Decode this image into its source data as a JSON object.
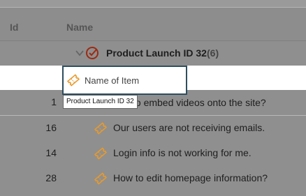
{
  "header": {
    "id_label": "Id",
    "name_label": "Name"
  },
  "group": {
    "title": "Product Launch ID 32",
    "count": "(6)"
  },
  "editor": {
    "placeholder": "Name of Item",
    "tooltip": "Product Launch ID 32"
  },
  "rows": [
    {
      "id": "1",
      "name": "How to embed videos onto the site?"
    },
    {
      "id": "16",
      "name": "Our users are not receiving emails."
    },
    {
      "id": "14",
      "name": "Login info is not working for me."
    },
    {
      "id": "28",
      "name": "How to edit homepage information?"
    }
  ],
  "visible_row1_text": "to embed videos onto the site?",
  "colors": {
    "accent_orange": "#e89a2c",
    "check_red": "#9b2b12",
    "edit_border": "#2e4e5e"
  },
  "icons": {
    "chevron": "chevron-down-icon",
    "check": "check-circle-icon",
    "ticket": "ticket-icon"
  }
}
